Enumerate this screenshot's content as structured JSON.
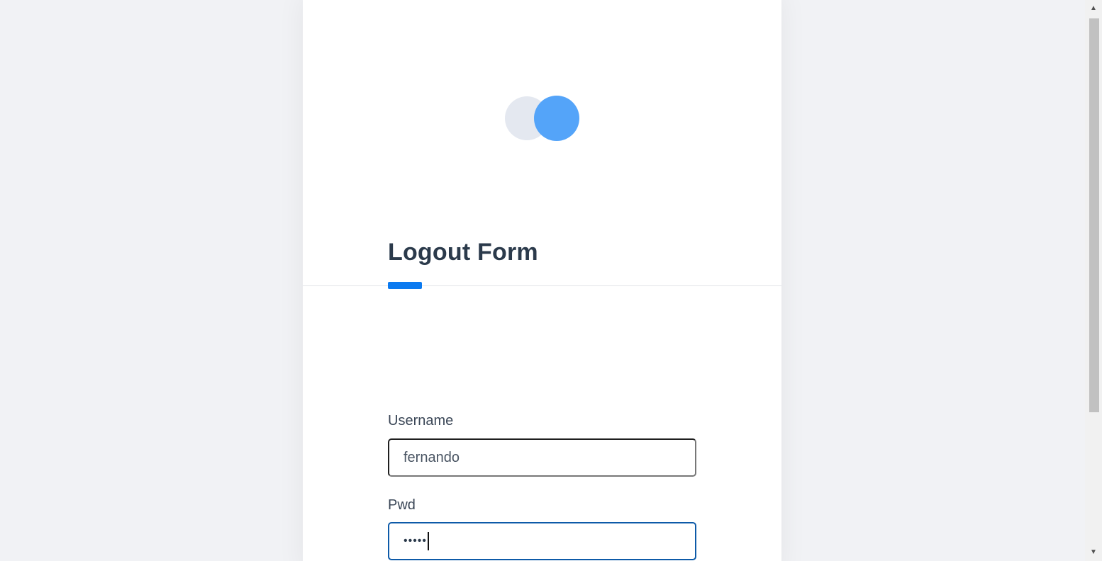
{
  "form": {
    "title": "Logout Form",
    "username_label": "Username",
    "username_value": "fernando",
    "password_label": "Pwd",
    "password_mask": "•••••"
  },
  "logo": {
    "icon": "two-circles-logo",
    "color_light": "#e4e8f0",
    "color_accent": "#54a4f9"
  },
  "colors": {
    "accent": "#0b7af0",
    "heading": "#2b3a4b",
    "focus_border": "#0d5aa8"
  },
  "scrollbar": {
    "up_glyph": "▲",
    "down_glyph": "▼"
  }
}
